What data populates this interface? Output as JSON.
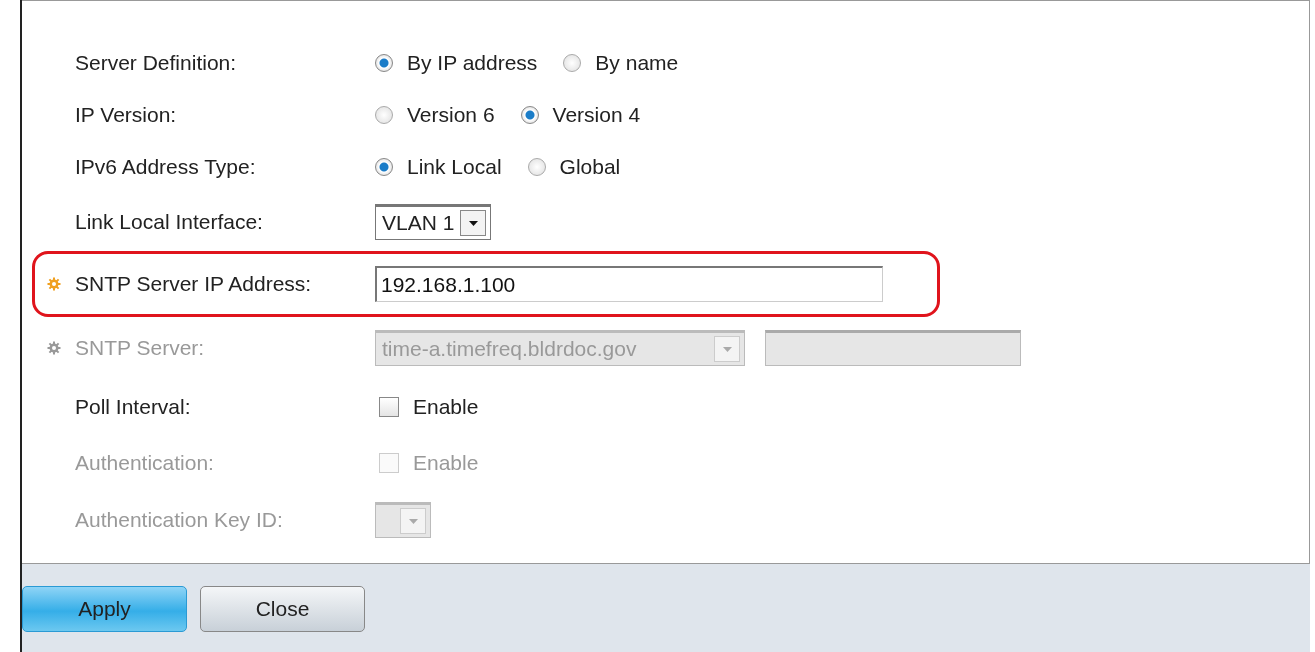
{
  "form": {
    "rows": [
      {
        "kind": "radio",
        "label": "Server Definition:",
        "disabled": false,
        "required": false,
        "highlighted": false,
        "options": [
          {
            "label": "By IP address",
            "selected": true
          },
          {
            "label": "By name",
            "selected": false
          }
        ]
      },
      {
        "kind": "radio",
        "label": "IP Version:",
        "disabled": false,
        "required": false,
        "highlighted": false,
        "options": [
          {
            "label": "Version 6",
            "selected": false
          },
          {
            "label": "Version 4",
            "selected": true
          }
        ]
      },
      {
        "kind": "radio",
        "label": "IPv6 Address Type:",
        "disabled": false,
        "required": false,
        "highlighted": false,
        "options": [
          {
            "label": "Link Local",
            "selected": true
          },
          {
            "label": "Global",
            "selected": false
          }
        ]
      },
      {
        "kind": "select",
        "label": "Link Local Interface:",
        "disabled": false,
        "required": false,
        "highlighted": false,
        "value": "VLAN 1"
      },
      {
        "kind": "text",
        "label": "SNTP Server IP Address:",
        "disabled": false,
        "required": true,
        "highlighted": true,
        "value": "192.168.1.100"
      },
      {
        "kind": "select_field",
        "label": "SNTP Server:",
        "disabled": true,
        "required": true,
        "highlighted": false,
        "value": "time-a.timefreq.bldrdoc.gov"
      },
      {
        "kind": "checkbox",
        "label": "Poll Interval:",
        "disabled": false,
        "required": false,
        "highlighted": false,
        "option": "Enable",
        "checked": false
      },
      {
        "kind": "checkbox",
        "label": "Authentication:",
        "disabled": true,
        "required": false,
        "highlighted": false,
        "option": "Enable",
        "checked": false
      },
      {
        "kind": "select",
        "label": "Authentication Key ID:",
        "disabled": true,
        "required": false,
        "highlighted": false
      }
    ]
  },
  "buttons": [
    {
      "label": "Apply",
      "kind": "primary"
    },
    {
      "label": "Close",
      "kind": "secondary"
    }
  ]
}
